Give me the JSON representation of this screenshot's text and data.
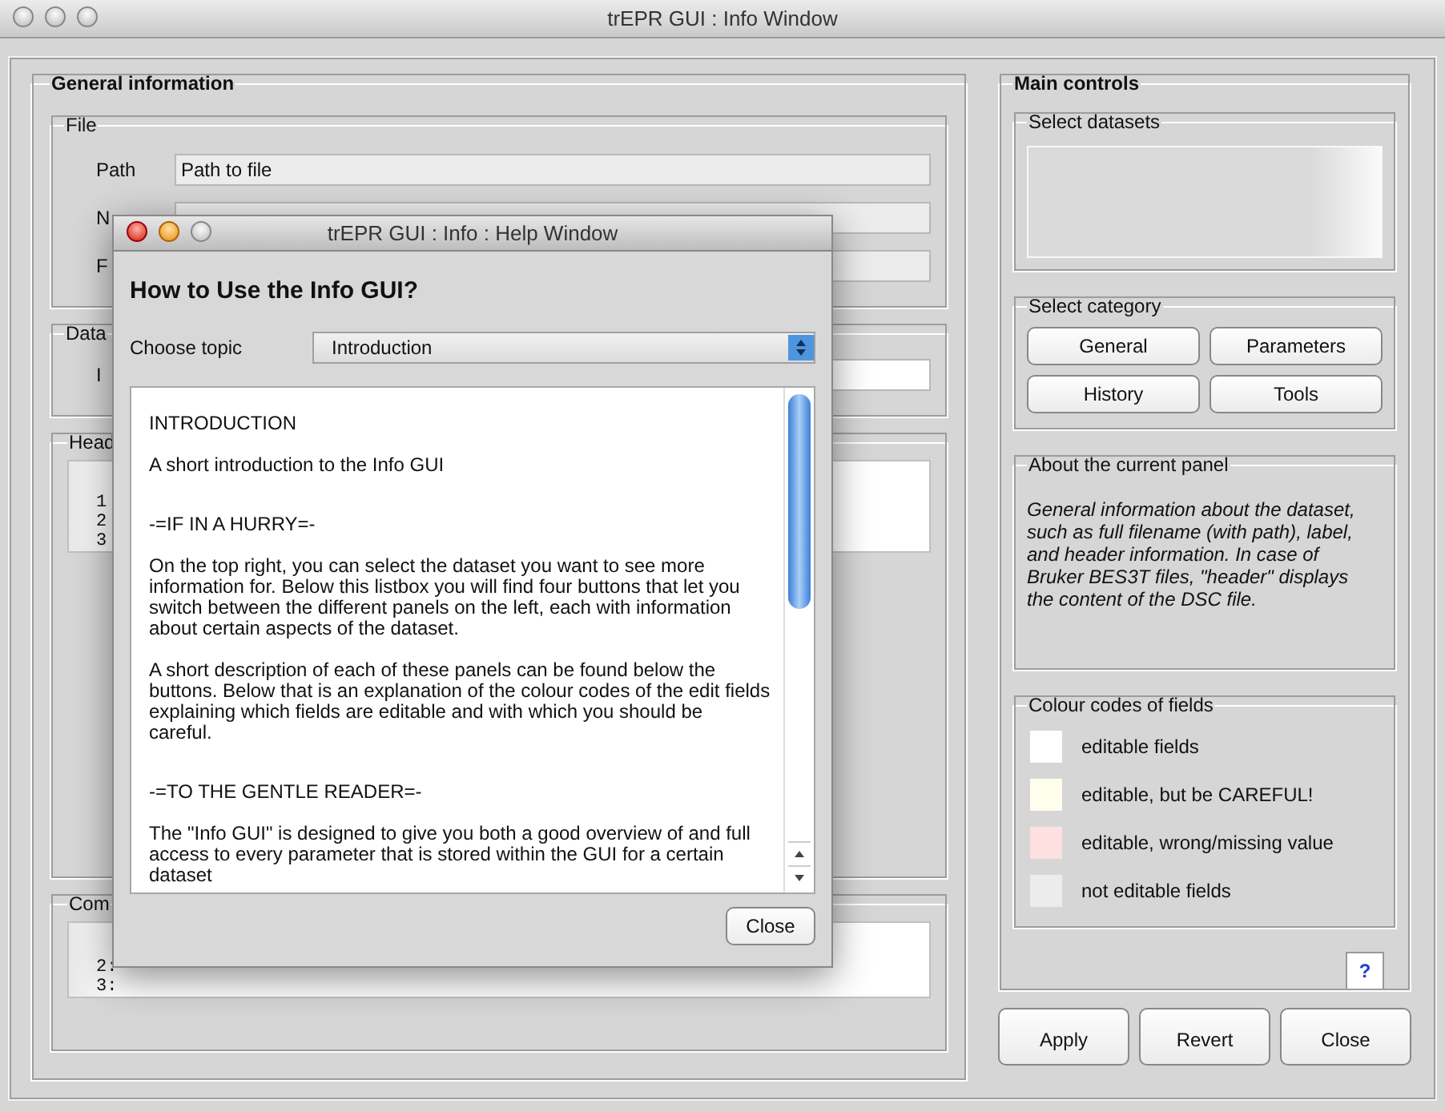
{
  "window": {
    "title": "trEPR GUI : Info Window"
  },
  "general": {
    "title": "General information",
    "file": {
      "title": "File",
      "fields": [
        {
          "label": "Path",
          "value": "Path to file"
        },
        {
          "label": "N"
        },
        {
          "label": "F"
        }
      ]
    },
    "dataset": {
      "title": "Data",
      "label": "I"
    },
    "header": {
      "title": "Head",
      "lines": [
        "1",
        "2",
        "3"
      ]
    },
    "comment": {
      "title": "Com",
      "lines": [
        "2:",
        "3:"
      ]
    }
  },
  "main_controls": {
    "title": "Main controls",
    "datasets": {
      "title": "Select datasets"
    },
    "category": {
      "title": "Select category",
      "buttons": [
        "General",
        "Parameters",
        "History",
        "Tools"
      ]
    },
    "about": {
      "title": "About the current panel",
      "text": "General information about the dataset, such as full filename (with path), label, and header information. In case of Bruker BES3T files, \"header\" displays the content of the DSC file."
    },
    "colour_codes": {
      "title": "Colour codes of fields",
      "items": [
        {
          "label": "editable fields",
          "color": "#ffffff"
        },
        {
          "label": "editable, but be CAREFUL!",
          "color": "#fffdec"
        },
        {
          "label": "editable, wrong/missing value",
          "color": "#ffe0e0"
        },
        {
          "label": "not editable fields",
          "color": "#ececec"
        }
      ]
    },
    "help_button": "?"
  },
  "buttons": [
    "Apply",
    "Revert",
    "Close"
  ],
  "help_window": {
    "title": "trEPR GUI : Info : Help Window",
    "heading": "How to Use the Info GUI?",
    "topic_label": "Choose topic",
    "topic": "Introduction",
    "paragraphs": [
      {
        "kind": "heading",
        "text": "INTRODUCTION"
      },
      {
        "kind": "text",
        "text": "A short introduction to the Info GUI"
      },
      {
        "kind": "section",
        "text": "-=IF IN A HURRY=-"
      },
      {
        "kind": "text",
        "text": "On the top right, you can select the dataset you want to see more information for. Below this listbox you will find four buttons that let you switch between the different panels on the left, each with information about certain aspects of the dataset."
      },
      {
        "kind": "text",
        "text": "A short description of each of these panels can be found below the buttons. Below that is an explanation of the colour codes of the edit fields explaining which fields are editable and with which you should be careful."
      },
      {
        "kind": "section",
        "text": "-=TO THE GENTLE READER=-"
      },
      {
        "kind": "text",
        "text": "The \"Info GUI\" is designed to give you both a good overview of and full access to every parameter that is stored within the GUI for a certain dataset"
      }
    ],
    "close": "Close"
  }
}
